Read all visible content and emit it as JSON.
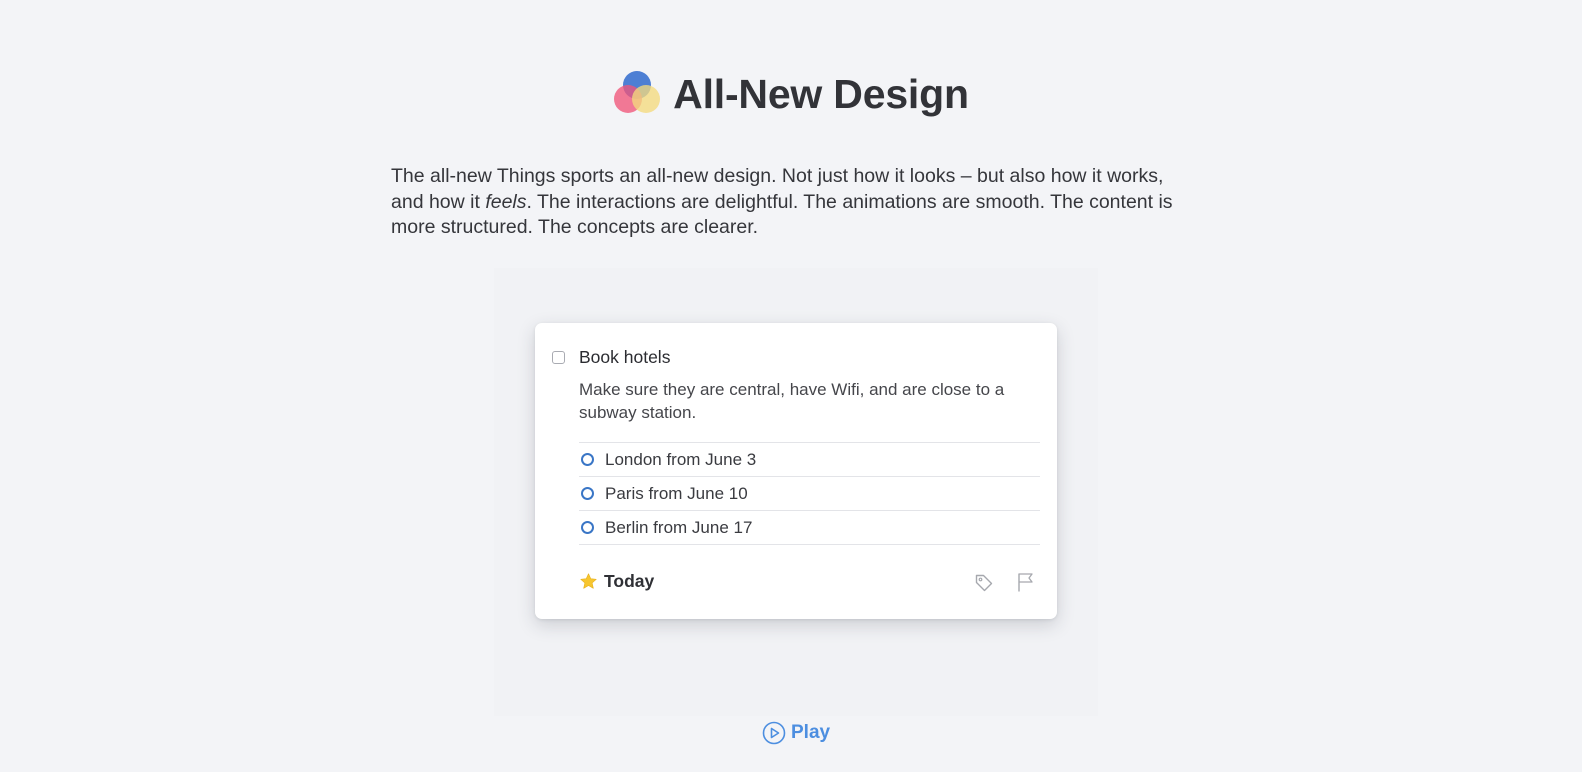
{
  "header": {
    "title": "All-New Design",
    "logo_icon": "things-overlapping-circles-icon"
  },
  "intro": {
    "text_before": "The all-new Things sports an all-new design. Not just how it looks – but also how it works, and how it ",
    "emphasis": "feels",
    "text_after": ". The interactions are delightful. The animations are smooth. The content is more structured. The concepts are clearer."
  },
  "task": {
    "title": "Book hotels",
    "notes": "Make sure they are central, have Wifi, and are close to a subway station.",
    "checklist": [
      {
        "label": "London from June 3"
      },
      {
        "label": "Paris from June 10"
      },
      {
        "label": "Berlin from June 17"
      }
    ],
    "when": {
      "label": "Today",
      "icon": "star-icon"
    },
    "actions": {
      "tag_icon": "tag-icon",
      "flag_icon": "flag-icon"
    }
  },
  "play": {
    "label": "Play",
    "icon": "play-circle-icon"
  },
  "colors": {
    "background": "#f3f4f7",
    "accent_blue": "#4c8ee0",
    "checklist_ring": "#3a76c6",
    "star_yellow": "#f7c62f"
  }
}
